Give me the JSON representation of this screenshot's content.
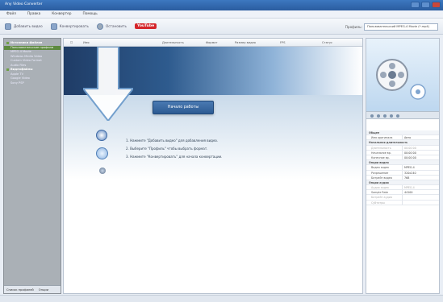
{
  "window": {
    "title": "Any Video Converter"
  },
  "menu": [
    "Файл",
    "Правка",
    "Конвертер",
    "Помощь"
  ],
  "toolbar": {
    "add_video": "Добавить видео",
    "convert": "Конвертировать",
    "stop": "Остановить",
    "youtube": "YouTube",
    "profile_label": "Профиль:",
    "profile_value": "Пользовательский MPEG-4 Movie (*.mp4)"
  },
  "sidebar": {
    "items": [
      {
        "label": "Источники файлов",
        "type": "cat"
      },
      {
        "label": "Пользовательские профили",
        "type": "sel"
      },
      {
        "label": "MPEG-4 Movie",
        "type": "item"
      },
      {
        "label": "Windows Media Video",
        "type": "item"
      },
      {
        "label": "Custom Video Format",
        "type": "item"
      },
      {
        "label": "Audio Files",
        "type": "item"
      },
      {
        "label": "Видеофайлы",
        "type": "cat"
      },
      {
        "label": "Apple TV",
        "type": "item"
      },
      {
        "label": "Google Video",
        "type": "item"
      },
      {
        "label": "Sony PSP",
        "type": "item"
      }
    ],
    "tab_profiles": "Список профилей",
    "tab_options": "Опции"
  },
  "columns": [
    "Имя",
    "Длительность",
    "Формат",
    "Размер видео",
    "FPS",
    "Статус"
  ],
  "main": {
    "start_button": "Начало работы",
    "steps": [
      "1. Нажмите \"Добавить видео\" для добавления видео.",
      "2. Выберите \"Профиль\" чтобы выбрать формат.",
      "3. Нажмите \"Конвертировать\" для начала конвертации."
    ]
  },
  "info": {
    "rows": [
      {
        "k": "Общее",
        "v": "",
        "type": "sec"
      },
      {
        "k": "Имя оригинала",
        "v": "Авто"
      },
      {
        "k": "Начальная длительность",
        "v": "",
        "type": "sec"
      },
      {
        "k": "Длительность",
        "v": "00:00:00",
        "type": "dim"
      },
      {
        "k": "Начальное вр.",
        "v": "00:00:00"
      },
      {
        "k": "Конечное вр.",
        "v": "00:00:00"
      },
      {
        "k": "Опции видео",
        "v": "",
        "type": "sec"
      },
      {
        "k": "Видео кодек",
        "v": "MPEG-4"
      },
      {
        "k": "Разрешение",
        "v": "320x240"
      },
      {
        "k": "Битрейт видео",
        "v": "768"
      },
      {
        "k": "Опции аудио",
        "v": "",
        "type": "sec"
      },
      {
        "k": "Аудио кодек",
        "v": "MPEG-4",
        "type": "dim"
      },
      {
        "k": "Sample Rate",
        "v": "44100"
      },
      {
        "k": "Битрейт аудио",
        "v": "",
        "type": "dim"
      },
      {
        "k": "Субтитры",
        "v": "",
        "type": "dim"
      }
    ]
  },
  "status": {
    "text": ""
  }
}
